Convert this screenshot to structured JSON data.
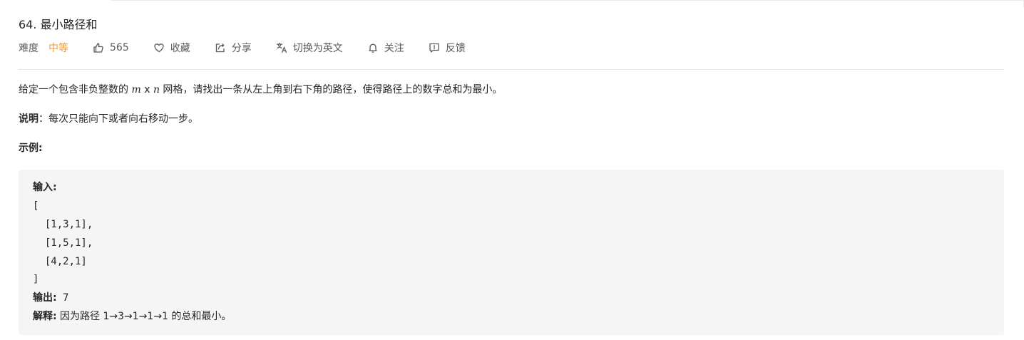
{
  "problem": {
    "title": "64. 最小路径和"
  },
  "meta": {
    "difficulty_label": "难度",
    "difficulty_value": "中等",
    "difficulty_color": "#ef9834",
    "likes": "565",
    "favorite": "收藏",
    "share": "分享",
    "switch_language": "切换为英文",
    "follow": "关注",
    "feedback": "反馈",
    "icons": [
      "thumbs-up-icon",
      "heart-icon",
      "share-icon",
      "translate-icon",
      "bell-icon",
      "feedback-icon"
    ]
  },
  "description": {
    "p1_before": "给定一个包含非负整数的",
    "m": "m",
    "times": "x",
    "n": "n",
    "p1_after": "网格，请找出一条从左上角到右下角的路径，使得路径上的数字总和为最小。",
    "note_label": "说明",
    "note_text": "：每次只能向下或者向右移动一步。",
    "example_heading": "示例:"
  },
  "example": {
    "input_label": "输入:",
    "lines": [
      "[",
      "  [1,3,1],",
      "  [1,5,1],",
      "  [4,2,1]",
      "]"
    ],
    "output_label": "输出:",
    "output_value": " 7",
    "explain_label": "解释:",
    "explain_text": " 因为路径 1→3→1→1→1 的总和最小。"
  }
}
